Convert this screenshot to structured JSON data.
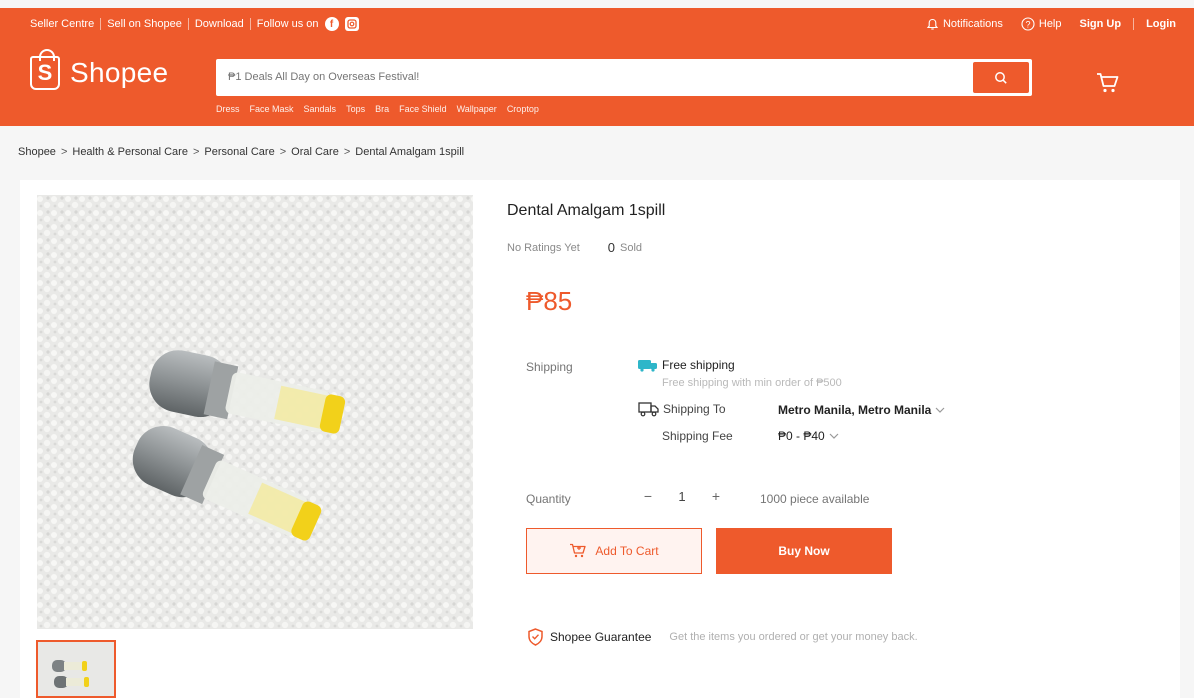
{
  "topbar": {
    "links": [
      "Seller Centre",
      "Sell on Shopee",
      "Download",
      "Follow us on"
    ],
    "notifications": "Notifications",
    "help": "Help",
    "signup": "Sign Up",
    "login": "Login"
  },
  "header": {
    "logo_text": "Shopee",
    "logo_glyph": "S",
    "search_placeholder": "₱1 Deals All Day on Overseas Festival!",
    "suggestions": [
      "Dress",
      "Face Mask",
      "Sandals",
      "Tops",
      "Bra",
      "Face Shield",
      "Wallpaper",
      "Croptop"
    ]
  },
  "breadcrumb": [
    "Shopee",
    "Health & Personal Care",
    "Personal Care",
    "Oral Care",
    "Dental Amalgam 1spill"
  ],
  "product": {
    "title": "Dental Amalgam 1spill",
    "ratings": "No Ratings Yet",
    "sold_count": "0",
    "sold_label": "Sold",
    "price": "₱85"
  },
  "shipping": {
    "label": "Shipping",
    "free_title": "Free shipping",
    "free_sub": "Free shipping with min order of ₱500",
    "to_label": "Shipping To",
    "to_value": "Metro Manila, Metro Manila",
    "fee_label": "Shipping Fee",
    "fee_value": "₱0 - ₱40"
  },
  "quantity": {
    "label": "Quantity",
    "minus": "−",
    "value": "1",
    "plus": "+",
    "available": "1000 piece available"
  },
  "actions": {
    "add_to_cart": "Add To Cart",
    "buy_now": "Buy Now"
  },
  "guarantee": {
    "title": "Shopee Guarantee",
    "text": "Get the items you ordered or get your money back."
  },
  "colors": {
    "brand": "#ee5a2c",
    "amalgam_cap": "#f2d11a"
  }
}
